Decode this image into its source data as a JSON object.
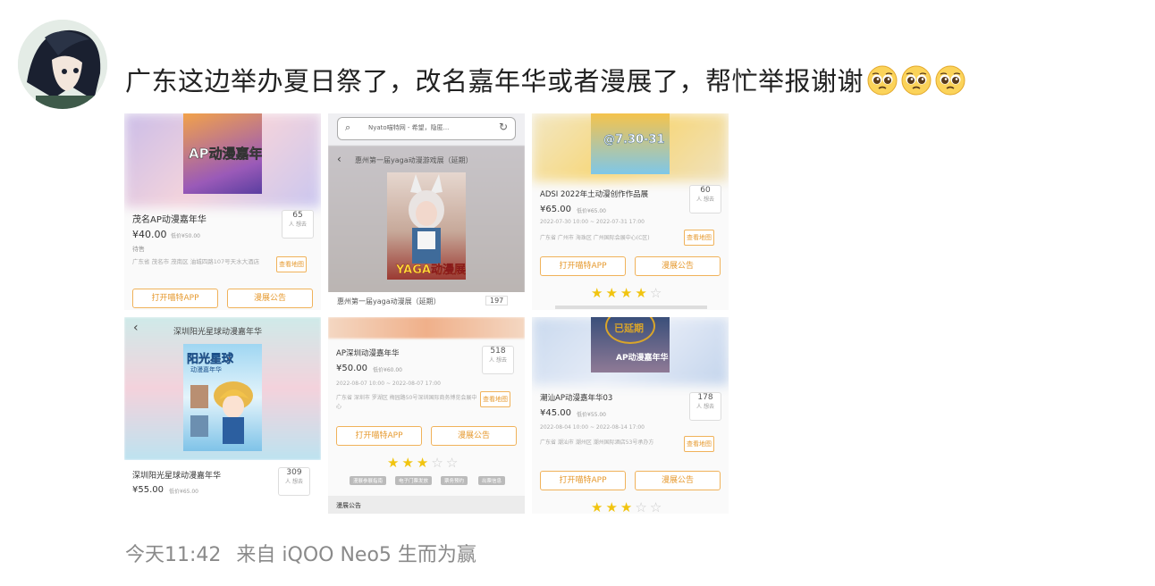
{
  "post": {
    "text": "广东这边举办夏日祭了，改名嘉年华或者漫展了，帮忙举报谢谢",
    "emoji": [
      "pleading-face-emoji",
      "pleading-face-emoji",
      "pleading-face-emoji"
    ]
  },
  "footer": {
    "time": "今天11:42",
    "source": "来自 iQOO Neo5 生而为赢"
  },
  "tiles": {
    "t1": {
      "poster_title": "AP动漫嘉年华",
      "event": "茂名AP动漫嘉年华",
      "price": "¥40.00",
      "orig": "低价¥50.00",
      "count": "65",
      "count_unit": "人 想去",
      "status": "待售",
      "address": "广东省 茂名市 茂南区 油城四路107号天水大酒店",
      "map_btn": "查看地图",
      "btn1": "打开喵特APP",
      "btn2": "漫展公告"
    },
    "t2": {
      "search_text": "Nyato喵特网 - 希望，隐匿...",
      "page_title": "惠州第一届yaga动漫游戏展（延期）",
      "poster_title": "YAGA动漫展",
      "event": "惠州第一届yaga动漫展（延期）",
      "count": "197"
    },
    "t3": {
      "poster_date": "@7.30-31",
      "event": "ADSI 2022年土动漫创作作品展",
      "price": "¥65.00",
      "orig": "低价¥65.00",
      "count": "60",
      "count_unit": "人 想去",
      "time": "2022-07-30 10:00 ~ 2022-07-31 17:00",
      "address": "广东省 广州市 海珠区 广州国际会展中心(C区)",
      "map_btn": "查看地图",
      "btn1": "打开喵特APP",
      "btn2": "漫展公告",
      "rating": 4
    },
    "t4": {
      "page_title": "深圳阳光星球动漫嘉年华",
      "poster_title": "阳光星球",
      "poster_sub": "动漫嘉年华",
      "event": "深圳阳光星球动漫嘉年华",
      "price": "¥55.00",
      "orig": "低价¥65.00",
      "count": "309",
      "count_unit": "人 想去"
    },
    "t5": {
      "event": "AP深圳动漫嘉年华",
      "price": "¥50.00",
      "orig": "低价¥60.00",
      "count": "518",
      "count_unit": "人 想去",
      "time": "2022-08-07 10:00 ~ 2022-08-07 17:00",
      "address": "广东省 深圳市 罗湖区 梅园路50号深圳国际商务博览会展中心",
      "map_btn": "查看地图",
      "btn1": "打开喵特APP",
      "btn2": "漫展公告",
      "rating": 3,
      "tags": [
        "漫展参展指南",
        "电子门票发放",
        "票务预约",
        "出票信息"
      ],
      "section": "漫展公告"
    },
    "t6": {
      "stamp": "已延期",
      "poster_title": "AP动漫嘉年华",
      "event": "潮汕AP动漫嘉年华03",
      "price": "¥45.00",
      "orig": "低价¥55.00",
      "count": "178",
      "count_unit": "人 想去",
      "time": "2022-08-04 10:00 ~ 2022-08-14 17:00",
      "address": "广东省 潮汕市 潮州区 潮州国际酒店53号承办方",
      "map_btn": "查看地图",
      "btn1": "打开喵特APP",
      "btn2": "漫展公告",
      "rating": 3
    }
  },
  "colors": {
    "accent": "#f0b25a",
    "star": "#f1c40f",
    "text": "#222222",
    "meta": "#8a8a8a"
  }
}
